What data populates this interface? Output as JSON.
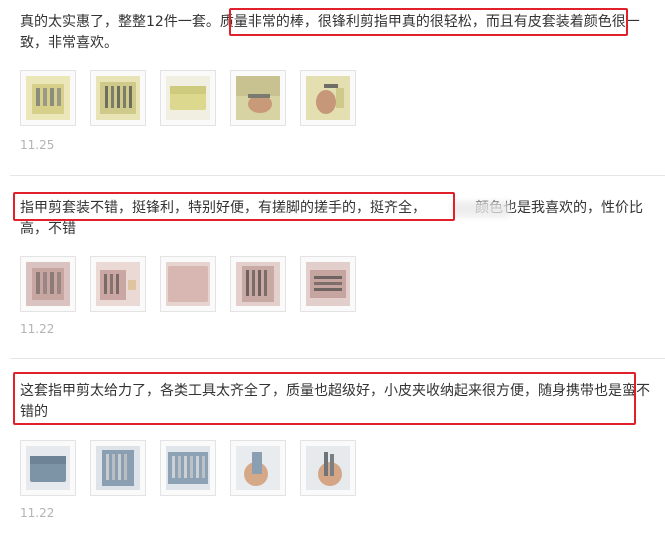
{
  "reviews": [
    {
      "text": "真的太实惠了，整整12件一套。质量非常的棒，很锋利剪指甲真的很轻松，而且有皮套装着颜色很一致，非常喜欢。",
      "date": "11.25",
      "photos": [
        "product-photo-1",
        "product-photo-2",
        "product-photo-3",
        "product-photo-4",
        "product-photo-5"
      ]
    },
    {
      "text": "指甲剪套装不错，挺锋利，特别好便，有搓脚的搓手的，挺齐全，           颜色也是我喜欢的，性价比高，不错",
      "date": "11.22",
      "photos": [
        "product-photo-1",
        "product-photo-2",
        "product-photo-3",
        "product-photo-4",
        "product-photo-5"
      ]
    },
    {
      "text": "这套指甲剪太给力了，各类工具太齐全了，质量也超级好，小皮夹收纳起来很方便，随身携带也是蛮不错的",
      "date": "11.22",
      "photos": [
        "product-photo-1",
        "product-photo-2",
        "product-photo-3",
        "product-photo-4",
        "product-photo-5"
      ]
    }
  ],
  "colors": {
    "highlight": "#e0202a",
    "date": "#b3b3b3",
    "text": "#333333",
    "divider": "#e6e6e6"
  }
}
